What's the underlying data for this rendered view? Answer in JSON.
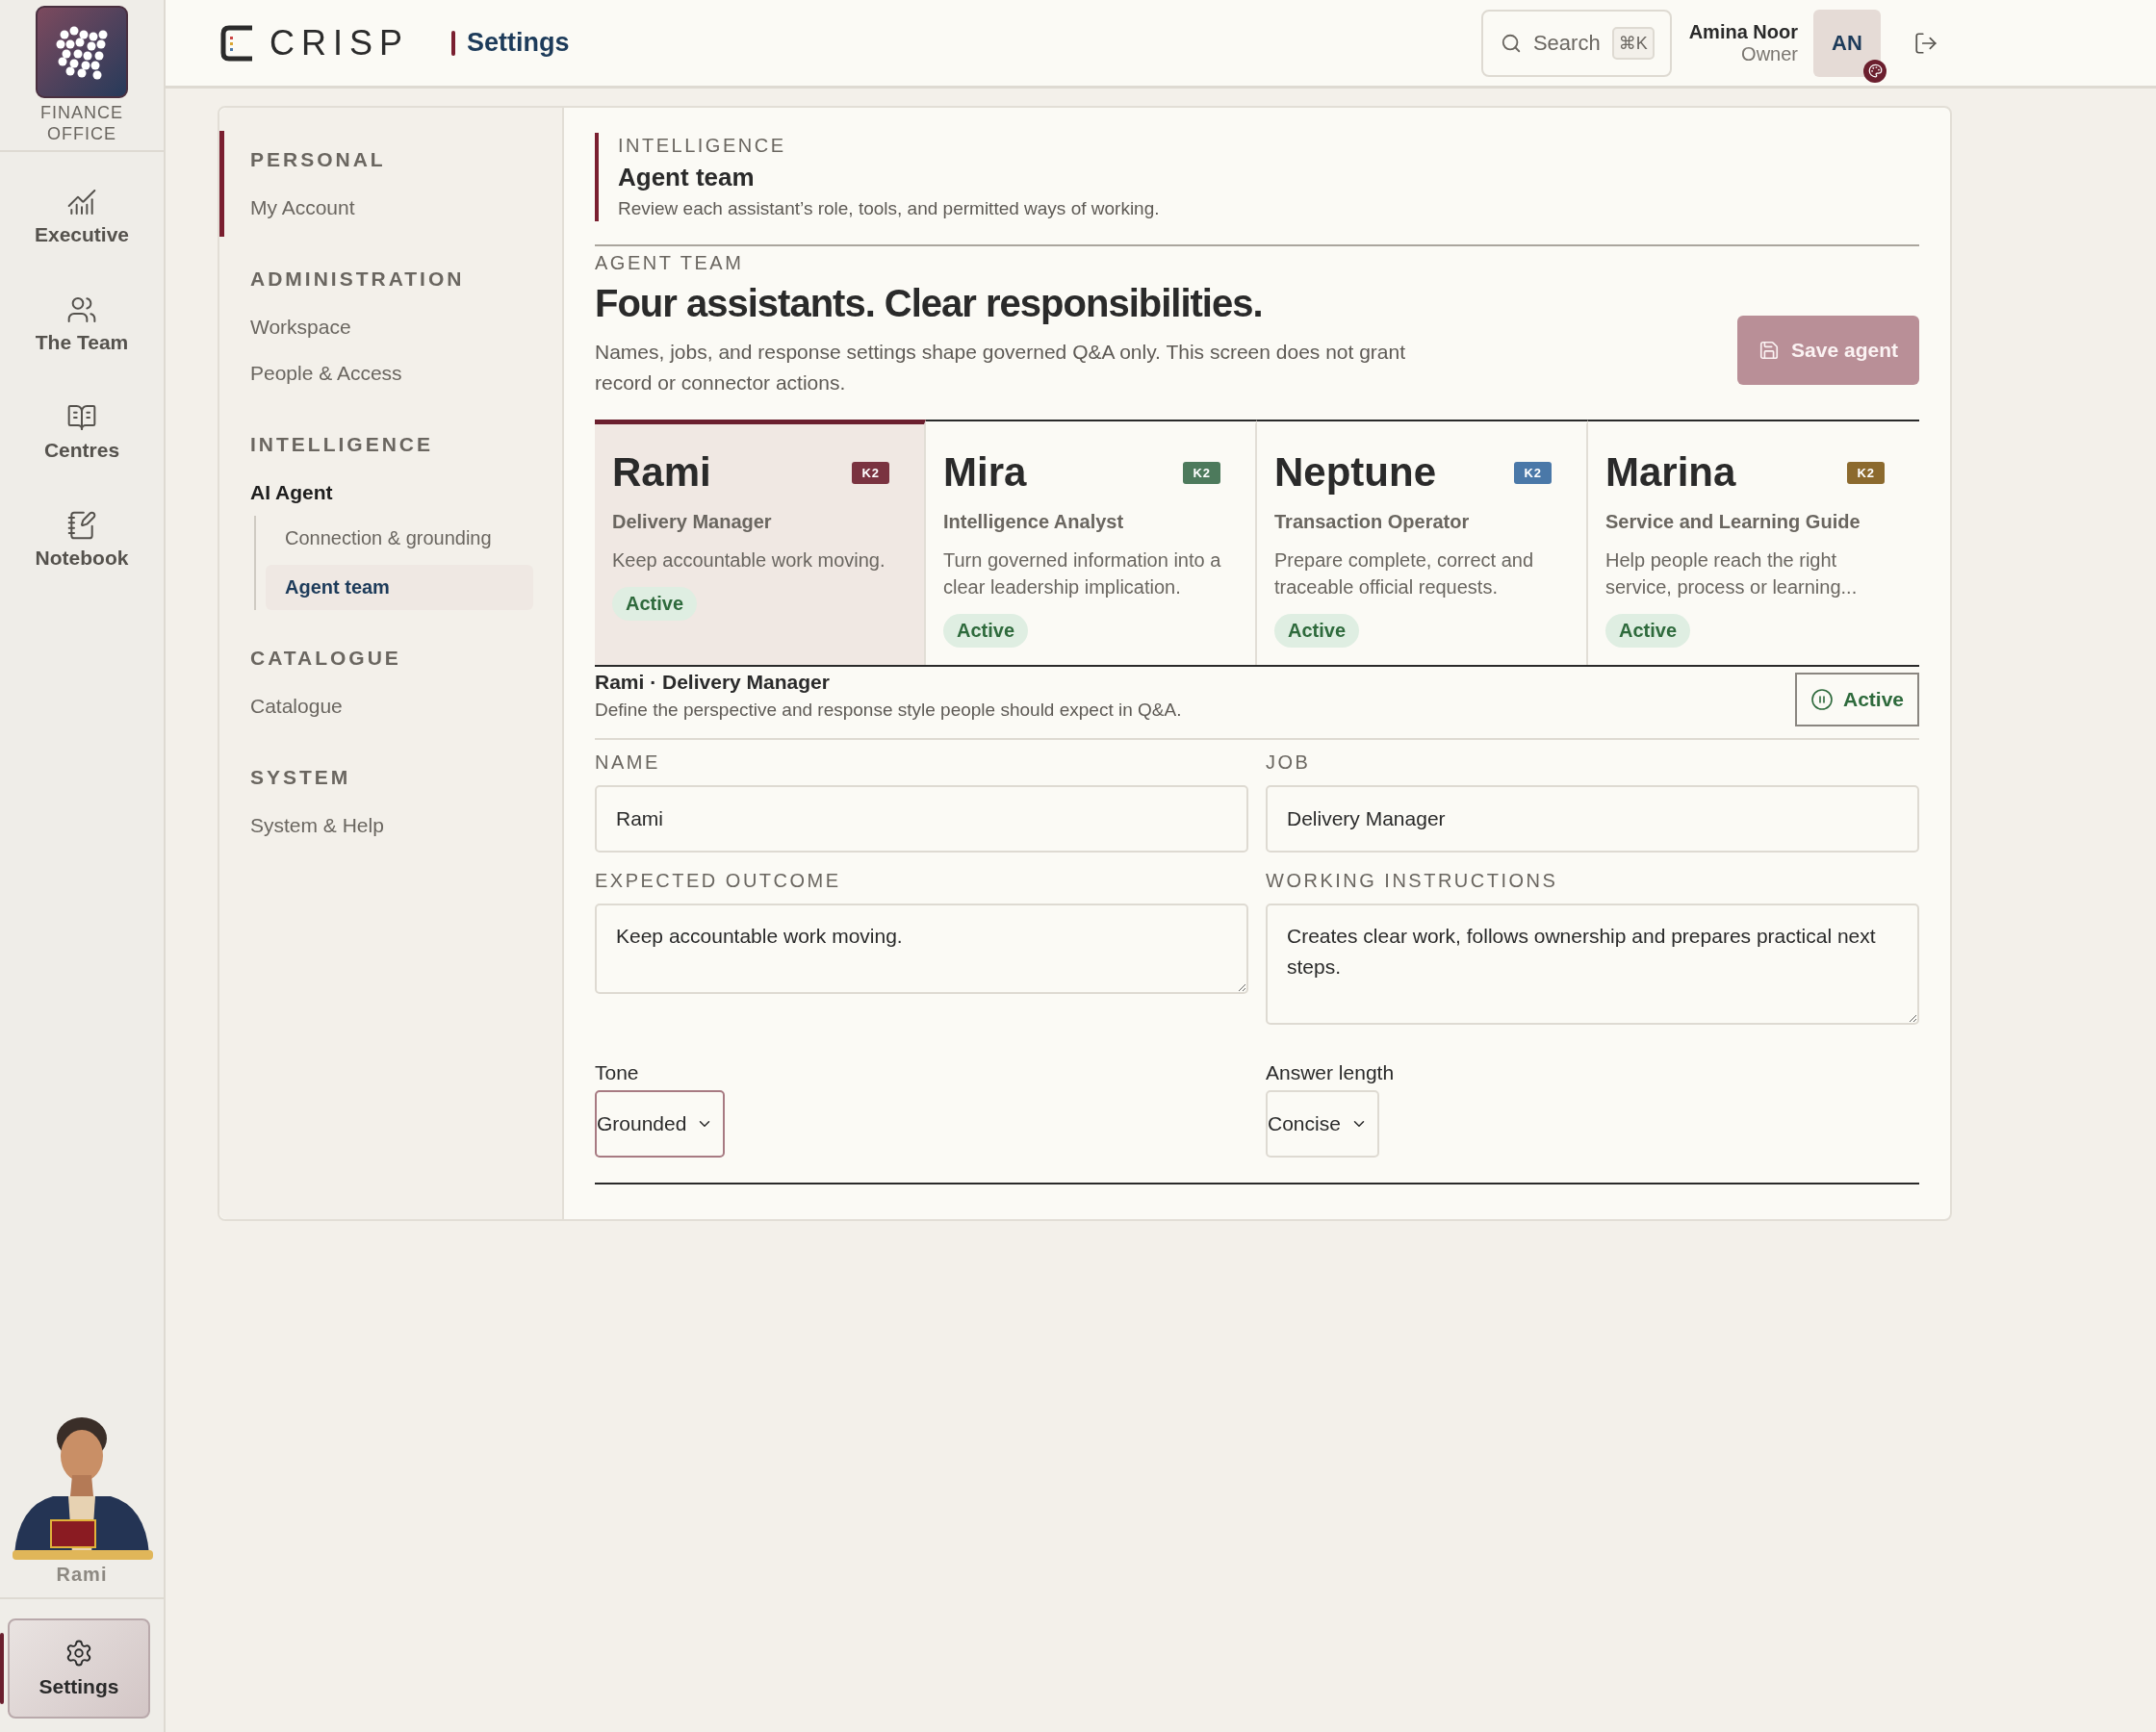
{
  "org": {
    "name": "FINANCE OFFICE"
  },
  "rail": [
    {
      "label": "Executive",
      "selected": false
    },
    {
      "label": "The Team",
      "selected": false
    },
    {
      "label": "Centres",
      "selected": false
    },
    {
      "label": "Notebook",
      "selected": false
    }
  ],
  "assistant": {
    "name": "Rami"
  },
  "rail_bottom": {
    "label": "Settings",
    "selected": true
  },
  "header": {
    "brand": "CRISP",
    "page": "Settings",
    "search": {
      "placeholder": "Search",
      "shortcut": "⌘K"
    },
    "user": {
      "name": "Amina Noor",
      "role": "Owner",
      "initials": "AN"
    }
  },
  "nav": [
    {
      "heading": "PERSONAL",
      "items": [
        {
          "label": "My Account",
          "selected": false
        }
      ]
    },
    {
      "heading": "ADMINISTRATION",
      "items": [
        {
          "label": "Workspace",
          "selected": false
        },
        {
          "label": "People & Access",
          "selected": false
        }
      ]
    },
    {
      "heading": "INTELLIGENCE",
      "items": [
        {
          "label": "AI Agent",
          "selected": false,
          "expanded": true,
          "children": [
            {
              "label": "Connection & grounding",
              "selected": false
            },
            {
              "label": "Agent team",
              "selected": true
            }
          ]
        }
      ]
    },
    {
      "heading": "CATALOGUE",
      "items": [
        {
          "label": "Catalogue",
          "selected": false
        }
      ]
    },
    {
      "heading": "SYSTEM",
      "items": [
        {
          "label": "System & Help",
          "selected": false
        }
      ]
    }
  ],
  "page_header": {
    "eyebrow": "INTELLIGENCE",
    "title": "Agent team",
    "description": "Review each assistant’s role, tools, and permitted ways of working."
  },
  "section": {
    "eyebrow": "AGENT TEAM",
    "title": "Four assistants. Clear responsibilities.",
    "description": "Names, jobs, and response settings shape governed Q&A only. This screen does not grant record or connector actions.",
    "save_button": {
      "label": "Save agent",
      "disabled": true
    }
  },
  "agents": [
    {
      "name": "Rami",
      "badge": "K2",
      "color": "#7a3340",
      "job": "Delivery Manager",
      "outcome": "Keep accountable work moving.",
      "status": "Active",
      "selected": true
    },
    {
      "name": "Mira",
      "badge": "K2",
      "color": "#4d7a5c",
      "job": "Intelligence Analyst",
      "outcome": "Turn governed information into a clear leadership implication.",
      "status": "Active",
      "selected": false
    },
    {
      "name": "Neptune",
      "badge": "K2",
      "color": "#4a78a8",
      "job": "Transaction Operator",
      "outcome": "Prepare complete, correct and traceable official requests.",
      "status": "Active",
      "selected": false
    },
    {
      "name": "Marina",
      "badge": "K2",
      "color": "#8c6a2e",
      "job": "Service and Learning Guide",
      "outcome": "Help people reach the right service, process or learning...",
      "status": "Active",
      "selected": false
    }
  ],
  "editor": {
    "title": "Rami · Delivery Manager",
    "description": "Define the perspective and response style people should expect in Q&A.",
    "status_button": "Active",
    "fields": [
      {
        "label": "NAME",
        "value": "Rami",
        "kind": "input"
      },
      {
        "label": "JOB",
        "value": "Delivery Manager",
        "kind": "input"
      },
      {
        "label": "EXPECTED OUTCOME",
        "value": "Keep accountable work moving.",
        "kind": "textarea"
      },
      {
        "label": "WORKING INSTRUCTIONS",
        "value": "Creates clear work, follows ownership and prepares practical next steps.",
        "kind": "textarea"
      }
    ],
    "selects": [
      {
        "label": "Tone",
        "value": "Grounded",
        "focused": true
      },
      {
        "label": "Answer length",
        "value": "Concise",
        "focused": false
      }
    ]
  }
}
